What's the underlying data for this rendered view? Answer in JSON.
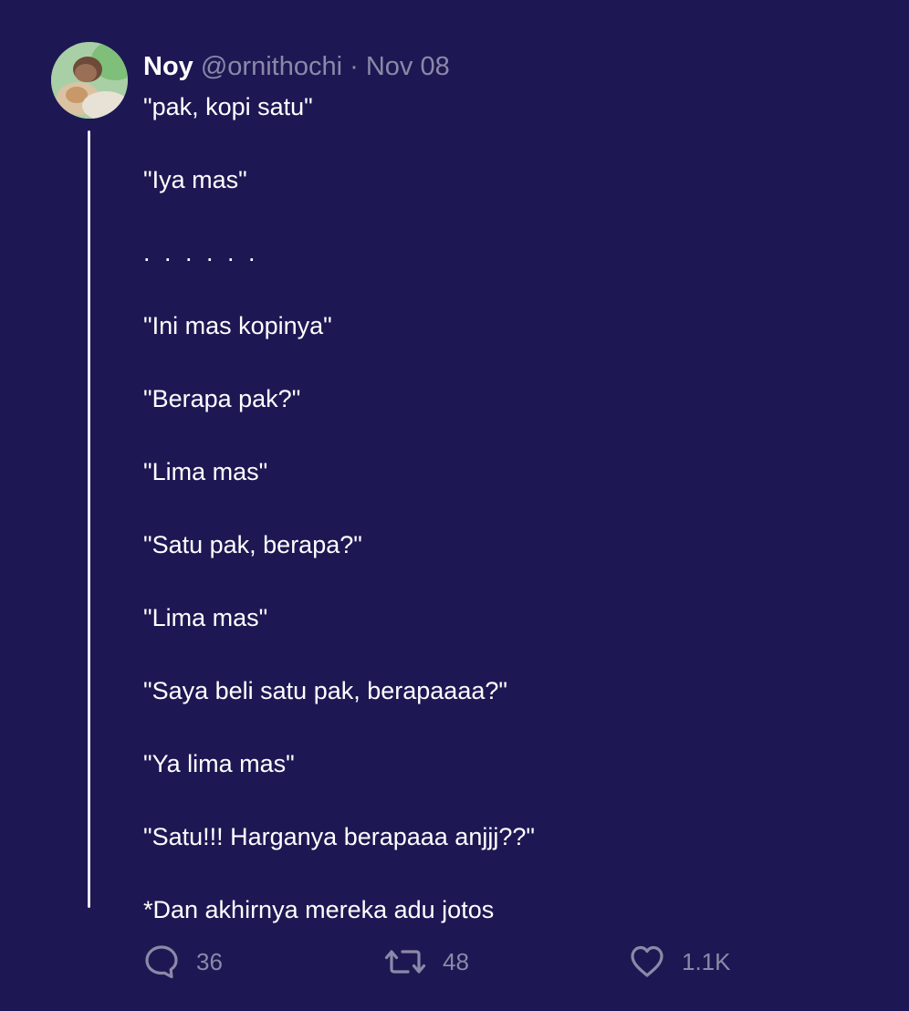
{
  "author": {
    "name": "Noy",
    "handle": "@ornithochi",
    "separator": "·",
    "date": "Nov 08"
  },
  "body_lines": [
    "\"pak, kopi satu\"",
    "\"Iya mas\"",
    ". . . . . .",
    "\"Ini mas kopinya\"",
    "\"Berapa pak?\"",
    "\"Lima mas\"",
    "\"Satu pak, berapa?\"",
    "\"Lima mas\"",
    "\"Saya beli satu pak, berapaaaa?\"",
    "\"Ya lima mas\"",
    "\"Satu!!! Harganya berapaaa anjjj??\"",
    "*Dan akhirnya mereka adu jotos"
  ],
  "actions": {
    "replies": {
      "icon": "reply-icon",
      "count": "36"
    },
    "retweets": {
      "icon": "retweet-icon",
      "count": "48"
    },
    "likes": {
      "icon": "heart-icon",
      "count": "1.1K"
    }
  },
  "colors": {
    "background": "#1d1853",
    "text": "#ffffff",
    "muted": "#8b89a8",
    "thread_line": "#e9e9f0"
  }
}
